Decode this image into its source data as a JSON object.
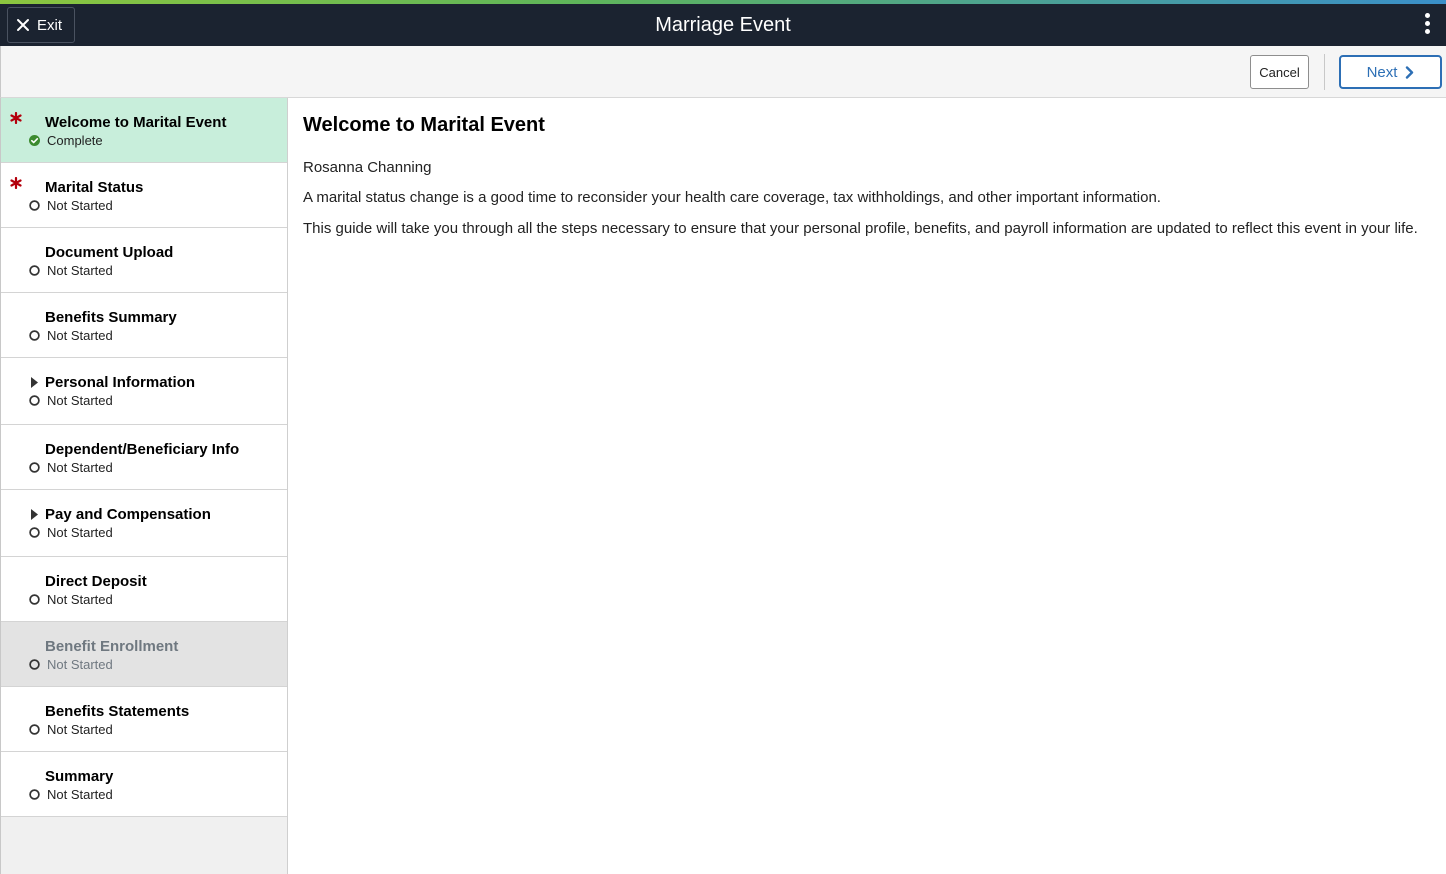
{
  "colors": {
    "banner_bg": "#1b2330",
    "active_step_bg": "#c8eedb",
    "disabled_step_bg": "#e3e3e3",
    "primary_blue": "#2d6fb5",
    "required_red": "#b3000c",
    "complete_green": "#3c8b2f"
  },
  "header": {
    "exit_label": "Exit",
    "title": "Marriage Event",
    "menu_icon": "kebab-menu-icon"
  },
  "toolbar": {
    "cancel_label": "Cancel",
    "next_label": "Next"
  },
  "sidebar": {
    "steps": [
      {
        "label": "Welcome to Marital Event",
        "status": "Complete",
        "required": true,
        "expandable": false,
        "state": "active"
      },
      {
        "label": "Marital Status",
        "status": "Not Started",
        "required": true,
        "expandable": false,
        "state": "normal"
      },
      {
        "label": "Document Upload",
        "status": "Not Started",
        "required": false,
        "expandable": false,
        "state": "normal"
      },
      {
        "label": "Benefits Summary",
        "status": "Not Started",
        "required": false,
        "expandable": false,
        "state": "normal"
      },
      {
        "label": "Personal Information",
        "status": "Not Started",
        "required": false,
        "expandable": true,
        "state": "normal"
      },
      {
        "label": "Dependent/Beneficiary Info",
        "status": "Not Started",
        "required": false,
        "expandable": false,
        "state": "normal"
      },
      {
        "label": "Pay and Compensation",
        "status": "Not Started",
        "required": false,
        "expandable": true,
        "state": "normal"
      },
      {
        "label": "Direct Deposit",
        "status": "Not Started",
        "required": false,
        "expandable": false,
        "state": "normal"
      },
      {
        "label": "Benefit Enrollment",
        "status": "Not Started",
        "required": false,
        "expandable": false,
        "state": "disabled"
      },
      {
        "label": "Benefits Statements",
        "status": "Not Started",
        "required": false,
        "expandable": false,
        "state": "normal"
      },
      {
        "label": "Summary",
        "status": "Not Started",
        "required": false,
        "expandable": false,
        "state": "normal"
      }
    ]
  },
  "main": {
    "title": "Welcome to Marital Event",
    "employee_name": "Rosanna Channing",
    "paragraph_1": "A marital status change is a good time to reconsider your health care coverage, tax withholdings, and other important information.",
    "paragraph_2": "This guide will take you through all the steps necessary to ensure that your personal profile, benefits, and payroll information are updated to reflect this event in your life."
  }
}
